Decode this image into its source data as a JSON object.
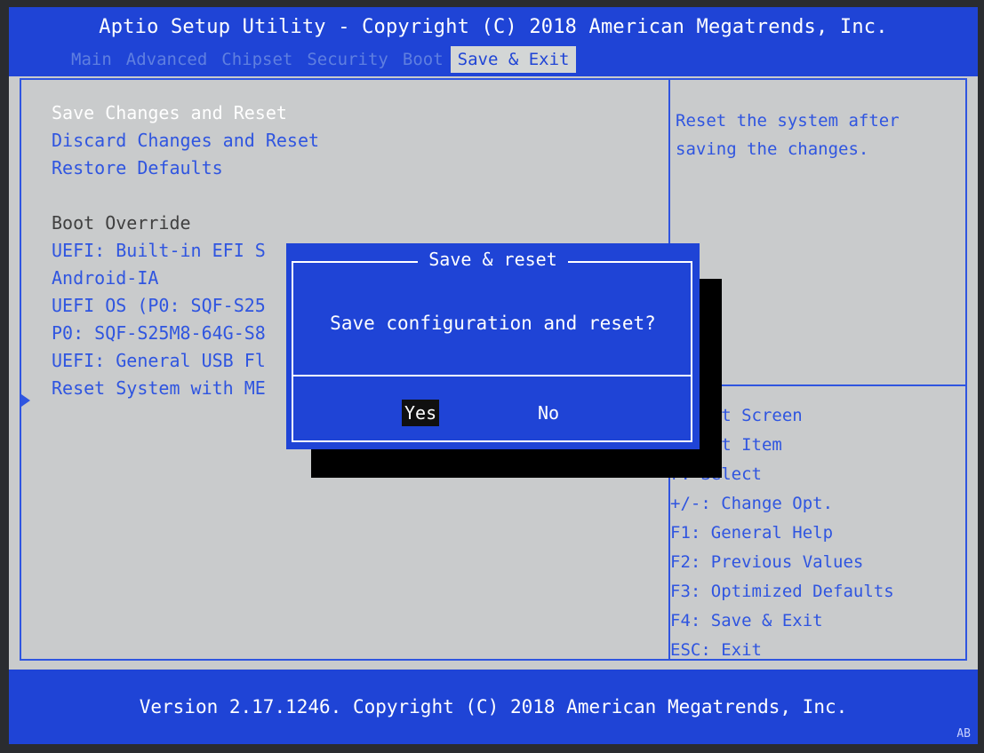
{
  "header": {
    "title": "Aptio Setup Utility - Copyright (C) 2018 American Megatrends, Inc.",
    "tabs": [
      "Main",
      "Advanced",
      "Chipset",
      "Security",
      "Boot",
      "Save & Exit"
    ],
    "active_tab": "Save & Exit"
  },
  "menu": {
    "items": [
      "Save Changes and Reset",
      "Discard Changes and Reset",
      "Restore Defaults",
      "Boot Override",
      "UEFI: Built-in EFI S",
      "Android-IA",
      "UEFI OS (P0: SQF-S25",
      "P0: SQF-S25M8-64G-S8",
      "UEFI: General USB Fl",
      "Reset System with ME"
    ],
    "selected": "Save Changes and Reset"
  },
  "help": {
    "description": "Reset the system after saving the changes."
  },
  "keys": [
    "Select Screen",
    "Select Item",
    "r: Select",
    "+/-: Change Opt.",
    "F1: General Help",
    "F2: Previous Values",
    "F3: Optimized Defaults",
    "F4: Save & Exit",
    "ESC: Exit"
  ],
  "dialog": {
    "title": "Save & reset",
    "message": "Save configuration and reset?",
    "yes_label": "Yes",
    "no_label": "No",
    "focused_button": "Yes"
  },
  "footer": {
    "version": "Version 2.17.1246. Copyright (C) 2018 American Megatrends, Inc.",
    "badge": "AB"
  },
  "colors": {
    "bios_blue": "#1f44d6",
    "panel_gray": "#c9cbcc",
    "text_blue": "#2f55e0",
    "white": "#ffffff"
  }
}
